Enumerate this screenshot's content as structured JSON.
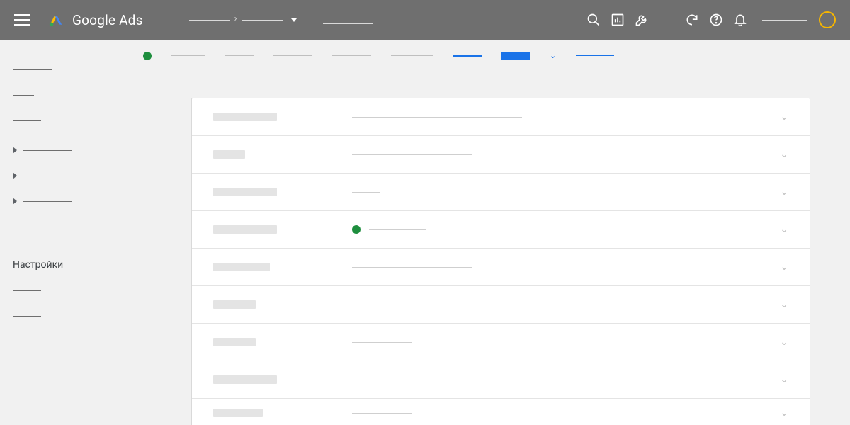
{
  "header": {
    "product": "Google Ads"
  },
  "sidebar": {
    "settings_label": "Настройки"
  },
  "status": {
    "campaign": "enabled",
    "row4": "enabled"
  },
  "colors": {
    "accent": "#1a73e8",
    "green": "#1e8e3e",
    "yellow": "#f7b600"
  }
}
